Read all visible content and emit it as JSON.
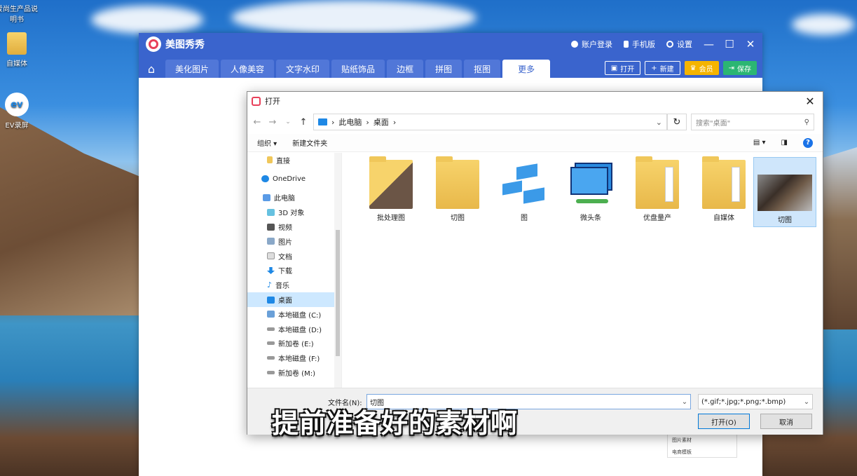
{
  "desktop": {
    "icons": [
      {
        "label": "爱尚生产品说明书",
        "icon": "document-icon"
      },
      {
        "label": "自媒体",
        "icon": "folder-icon"
      },
      {
        "label": "EV录屏",
        "icon": "ev-recorder-icon"
      }
    ]
  },
  "app": {
    "name": "美图秀秀",
    "top_right": [
      "账户登录",
      "手机版",
      "设置"
    ],
    "tabs": [
      "美化图片",
      "人像美容",
      "文字水印",
      "贴纸饰品",
      "边框",
      "拼图",
      "抠图",
      "更多"
    ],
    "active_tab": "更多",
    "toolbar": {
      "open": "打开",
      "new": "新建",
      "vip": "会员",
      "save": "保存"
    },
    "side_panel": [
      "图片素材",
      "电商模板"
    ]
  },
  "dialog": {
    "title": "打开",
    "breadcrumb": [
      "此电脑",
      "桌面"
    ],
    "search_placeholder": "搜索\"桌面\"",
    "organize": "组织",
    "new_folder": "新建文件夹",
    "tree": [
      {
        "label": "直接",
        "icon": "folder-icon"
      },
      {
        "label": "OneDrive",
        "icon": "cloud-icon"
      },
      {
        "label": "此电脑",
        "icon": "computer-icon"
      },
      {
        "label": "3D 对象",
        "icon": "cube-icon"
      },
      {
        "label": "视频",
        "icon": "video-icon"
      },
      {
        "label": "图片",
        "icon": "picture-icon"
      },
      {
        "label": "文档",
        "icon": "document-icon"
      },
      {
        "label": "下载",
        "icon": "download-icon"
      },
      {
        "label": "音乐",
        "icon": "music-icon"
      },
      {
        "label": "桌面",
        "icon": "desktop-icon"
      },
      {
        "label": "本地磁盘 (C:)",
        "icon": "drive-icon"
      },
      {
        "label": "本地磁盘 (D:)",
        "icon": "drive-icon"
      },
      {
        "label": "新加卷 (E:)",
        "icon": "drive-icon"
      },
      {
        "label": "本地磁盘 (F:)",
        "icon": "drive-icon"
      },
      {
        "label": "新加卷 (M:)",
        "icon": "drive-icon"
      }
    ],
    "selected_tree": "桌面",
    "files": [
      {
        "label": "批处理图",
        "kind": "image-folder"
      },
      {
        "label": "切图",
        "kind": "folder"
      },
      {
        "label": "图",
        "kind": "shortcut"
      },
      {
        "label": "微头条",
        "kind": "shortcut"
      },
      {
        "label": "优盘量产",
        "kind": "folder"
      },
      {
        "label": "自媒体",
        "kind": "folder"
      },
      {
        "label": "切图",
        "kind": "image",
        "selected": true
      }
    ],
    "filename_label": "文件名(N):",
    "filename_value": "切图",
    "filetype": "(*.gif;*.jpg;*.png;*.bmp)",
    "open_button": "打开(O)",
    "cancel_button": "取消"
  },
  "caption": "提前准备好的素材啊",
  "colors": {
    "app_blue": "#3a64cd",
    "folder_yellow": "#f7d36b",
    "selection": "#cde8ff"
  }
}
